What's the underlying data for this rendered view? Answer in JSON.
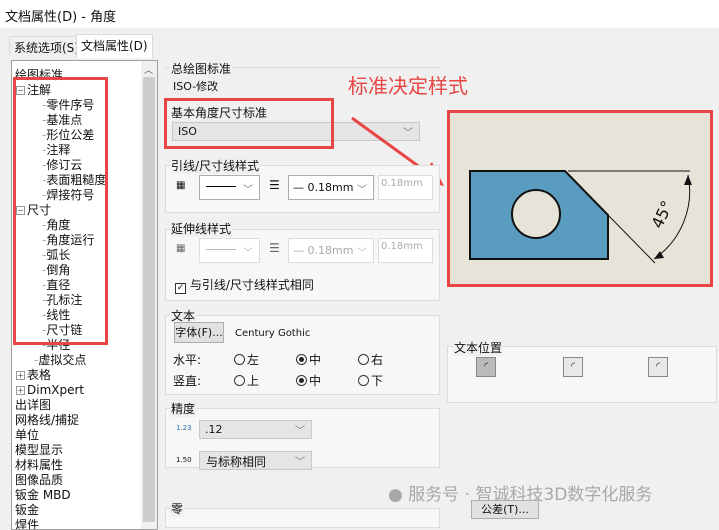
{
  "window": {
    "title": "文档属性(D) - 角度"
  },
  "tabs": [
    {
      "label": "系统选项(S)"
    },
    {
      "label": "文档属性(D)"
    }
  ],
  "tree": [
    {
      "label": "绘图标准",
      "level": 0
    },
    {
      "label": "注解",
      "level": 0,
      "expander": "minus"
    },
    {
      "label": "零件序号",
      "level": 2
    },
    {
      "label": "基准点",
      "level": 2
    },
    {
      "label": "形位公差",
      "level": 2
    },
    {
      "label": "注释",
      "level": 2
    },
    {
      "label": "修订云",
      "level": 2
    },
    {
      "label": "表面粗糙度",
      "level": 2
    },
    {
      "label": "焊接符号",
      "level": 2
    },
    {
      "label": "尺寸",
      "level": 0,
      "expander": "minus"
    },
    {
      "label": "角度",
      "level": 2
    },
    {
      "label": "角度运行",
      "level": 2
    },
    {
      "label": "弧长",
      "level": 2
    },
    {
      "label": "倒角",
      "level": 2
    },
    {
      "label": "直径",
      "level": 2
    },
    {
      "label": "孔标注",
      "level": 2
    },
    {
      "label": "线性",
      "level": 2
    },
    {
      "label": "尺寸链",
      "level": 2
    },
    {
      "label": "半径",
      "level": 2
    },
    {
      "label": "虚拟交点",
      "level": 1
    },
    {
      "label": "表格",
      "level": 0,
      "expander": "plus"
    },
    {
      "label": "DimXpert",
      "level": 0,
      "expander": "plus"
    },
    {
      "label": "出详图",
      "level": 0
    },
    {
      "label": "网格线/捕捉",
      "level": 0
    },
    {
      "label": "单位",
      "level": 0
    },
    {
      "label": "模型显示",
      "level": 0
    },
    {
      "label": "材料属性",
      "level": 0
    },
    {
      "label": "图像品质",
      "level": 0
    },
    {
      "label": "钣金 MBD",
      "level": 0
    },
    {
      "label": "钣金",
      "level": 0
    },
    {
      "label": "焊件",
      "level": 0
    }
  ],
  "overall": {
    "label": "总绘图标准",
    "value": "ISO-修改"
  },
  "base_std": {
    "label": "基本角度尺寸标准",
    "value": "ISO"
  },
  "annotation": "标准决定样式",
  "preview": {
    "angle_label": "45°"
  },
  "leader": {
    "label": "引线/尺寸线样式",
    "thickness": "— 0.18mm",
    "custom": "0.18mm"
  },
  "extension": {
    "label": "延伸线样式",
    "thickness": "— 0.18mm",
    "custom": "0.18mm",
    "same_checkbox": "与引线/尺寸线样式相同",
    "same_checked": true
  },
  "text": {
    "label": "文本",
    "font_button": "字体(F)...",
    "font_name": "Century Gothic",
    "horizontal_label": "水平:",
    "vertical_label": "竖直:",
    "h_options": [
      "左",
      "中",
      "右"
    ],
    "v_options": [
      "上",
      "中",
      "下"
    ],
    "h_selected": 1,
    "v_selected": 1
  },
  "text_position": {
    "label": "文本位置"
  },
  "precision": {
    "label": "精度",
    "primary": ".12",
    "tolerance": "与标称相同"
  },
  "zero": {
    "label": "零"
  },
  "tolerance_button": "公差(T)...",
  "watermark": "服务号 · 智诚科技3D数字化服务",
  "colors": {
    "annotation_red": "#e84545",
    "preview_bg": "#e6e4d8",
    "part_blue": "#5a9bc0"
  }
}
